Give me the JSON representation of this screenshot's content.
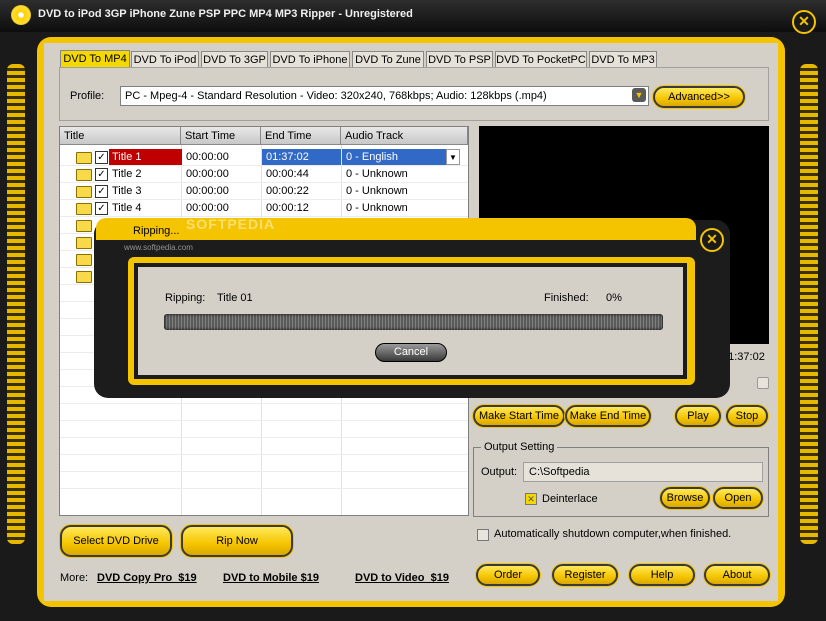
{
  "window": {
    "title": "DVD to iPod 3GP iPhone Zune PSP PPC MP4 MP3 Ripper - Unregistered",
    "close": "✕"
  },
  "tabs": [
    "DVD To MP4",
    "DVD To iPod",
    "DVD To 3GP",
    "DVD To iPhone",
    "DVD To Zune",
    "DVD To PSP",
    "DVD To PocketPC",
    "DVD To MP3"
  ],
  "profile": {
    "label": "Profile:",
    "value": "PC - Mpeg-4 - Standard Resolution - Video: 320x240, 768kbps; Audio: 128kbps (.mp4)",
    "advanced_label": "Advanced>>"
  },
  "table": {
    "headers": [
      "Title",
      "Start Time",
      "End Time",
      "Audio Track"
    ],
    "rows": [
      {
        "title": "Title 1",
        "start": "00:00:00",
        "end": "01:37:02",
        "audio": "0 - English",
        "checked": "✓"
      },
      {
        "title": "Title 2",
        "start": "00:00:00",
        "end": "00:00:44",
        "audio": "0 - Unknown",
        "checked": "✓"
      },
      {
        "title": "Title 3",
        "start": "00:00:00",
        "end": "00:00:22",
        "audio": "0 - Unknown",
        "checked": "✓"
      },
      {
        "title": "Title 4",
        "start": "00:00:00",
        "end": "00:00:12",
        "audio": "0 - Unknown",
        "checked": "✓"
      }
    ]
  },
  "player": {
    "time": "01:37:02",
    "make_start_label": "Make Start Time",
    "make_end_label": "Make End Time",
    "play_label": "Play",
    "stop_label": "Stop"
  },
  "output": {
    "group_label": "Output Setting",
    "output_label": "Output:",
    "path": "C:\\Softpedia",
    "deinterlace_label": "Deinterlace",
    "browse_label": "Browse",
    "open_label": "Open"
  },
  "shutdown_label": "Automatically shutdown computer,when finished.",
  "actions": {
    "select_drive_label": "Select DVD Drive",
    "rip_now_label": "Rip Now"
  },
  "more": {
    "label": "More:",
    "links": [
      "DVD Copy Pro  $19",
      "DVD to Mobile $19",
      "DVD to Video  $19"
    ]
  },
  "footer_buttons": [
    "Order",
    "Register",
    "Help",
    "About"
  ],
  "dialog": {
    "title": "Ripping...",
    "ripping_label": "Ripping:",
    "ripping_value": "Title 01",
    "finished_label": "Finished:",
    "finished_value": "0%",
    "progress_fraction": 0,
    "cancel_label": "Cancel"
  },
  "watermark": {
    "text": "SOFTPEDIA",
    "url": "www.softpedia.com"
  },
  "colors": {
    "accent": "#f5c400",
    "frame": "#1a1a1a",
    "selected_row": "#3169c6",
    "title_cell": "#c00000"
  }
}
